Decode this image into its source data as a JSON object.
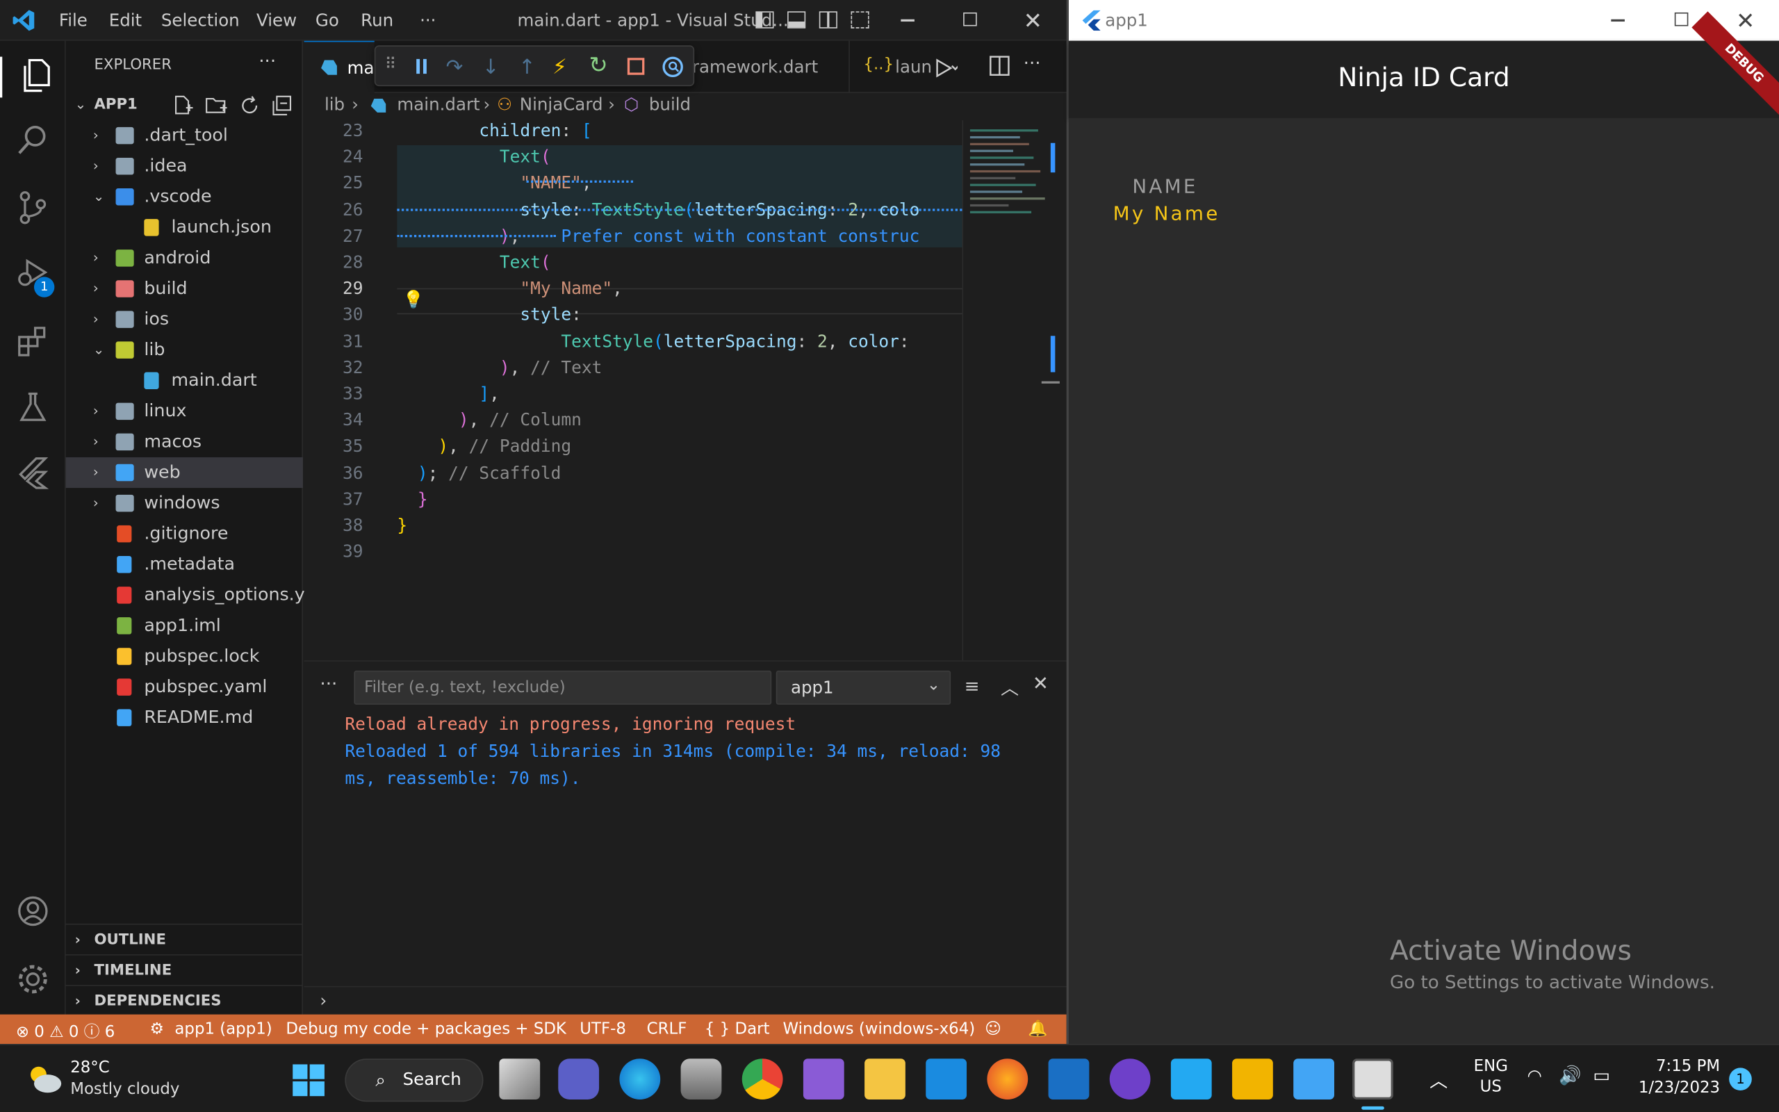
{
  "vscode": {
    "title": "main.dart - app1 - Visual Stud...",
    "menus": [
      "File",
      "Edit",
      "Selection",
      "View",
      "Go",
      "Run",
      "···"
    ],
    "explorer": {
      "header": "EXPLORER",
      "project": "APP1",
      "items": [
        {
          "label": ".dart_tool",
          "type": "folder",
          "expanded": false,
          "depth": 0,
          "color": "#8fa3b3"
        },
        {
          "label": ".idea",
          "type": "folder",
          "expanded": false,
          "depth": 0,
          "color": "#8fa3b3"
        },
        {
          "label": ".vscode",
          "type": "folder",
          "expanded": true,
          "depth": 0,
          "color": "#3b8eea"
        },
        {
          "label": "launch.json",
          "type": "file",
          "depth": 1,
          "color": "#e8c22e"
        },
        {
          "label": "android",
          "type": "folder",
          "expanded": false,
          "depth": 0,
          "color": "#7cb342"
        },
        {
          "label": "build",
          "type": "folder",
          "expanded": false,
          "depth": 0,
          "color": "#e57373"
        },
        {
          "label": "ios",
          "type": "folder",
          "expanded": false,
          "depth": 0,
          "color": "#8fa3b3"
        },
        {
          "label": "lib",
          "type": "folder",
          "expanded": true,
          "depth": 0,
          "color": "#c0ca33"
        },
        {
          "label": "main.dart",
          "type": "file",
          "depth": 1,
          "color": "#40a8e0"
        },
        {
          "label": "linux",
          "type": "folder",
          "expanded": false,
          "depth": 0,
          "color": "#8fa3b3"
        },
        {
          "label": "macos",
          "type": "folder",
          "expanded": false,
          "depth": 0,
          "color": "#8fa3b3"
        },
        {
          "label": "web",
          "type": "folder",
          "expanded": false,
          "depth": 0,
          "color": "#42a5f5",
          "selected": true
        },
        {
          "label": "windows",
          "type": "folder",
          "expanded": false,
          "depth": 0,
          "color": "#8fa3b3"
        },
        {
          "label": ".gitignore",
          "type": "file",
          "depth": 0,
          "color": "#e44d26"
        },
        {
          "label": ".metadata",
          "type": "file",
          "depth": 0,
          "color": "#42a5f5"
        },
        {
          "label": "analysis_options.y...",
          "type": "file",
          "depth": 0,
          "color": "#e53935"
        },
        {
          "label": "app1.iml",
          "type": "file",
          "depth": 0,
          "color": "#7cb342"
        },
        {
          "label": "pubspec.lock",
          "type": "file",
          "depth": 0,
          "color": "#fbc02d"
        },
        {
          "label": "pubspec.yaml",
          "type": "file",
          "depth": 0,
          "color": "#e53935"
        },
        {
          "label": "README.md",
          "type": "file",
          "depth": 0,
          "color": "#42a5f5"
        }
      ],
      "sections": [
        "OUTLINE",
        "TIMELINE",
        "DEPENDENCIES"
      ]
    },
    "tabs": [
      "ma",
      "ramework.dart",
      "laun"
    ],
    "breadcrumb": [
      "lib",
      "main.dart",
      "NinjaCard",
      "build"
    ],
    "code_lines": [
      {
        "n": "23",
        "html": "        <span class='kw'>children</span>: <span class='p3'>[</span>"
      },
      {
        "n": "24",
        "html": "          <span class='cls'>Text</span><span class='p2'>(</span>"
      },
      {
        "n": "25",
        "html": "            <span class='str'>\"NAME\"</span>,"
      },
      {
        "n": "26",
        "html": "            <span class='kw'>style</span>: <span class='cls'>TextStyle</span><span class='p3'>(</span><span class='kw'>letterSpacing</span>: <span class='num'>2</span>, <span class='kw'>colo</span>"
      },
      {
        "n": "27",
        "html": "          <span class='p2'>)</span>,    <span style='color:#3794ff'>Prefer const with constant construc</span>"
      },
      {
        "n": "28",
        "html": "          <span class='cls'>Text</span><span class='p2'>(</span>"
      },
      {
        "n": "29",
        "html": "            <span class='str'>\"My Name\"</span>,"
      },
      {
        "n": "30",
        "html": "            <span class='kw'>style</span>:"
      },
      {
        "n": "31",
        "html": "                <span class='cls'>TextStyle</span><span class='p3'>(</span><span class='kw'>letterSpacing</span>: <span class='num'>2</span>, <span class='kw'>color</span>:"
      },
      {
        "n": "32",
        "html": "          <span class='p2'>)</span>, <span class='cm'>// Text</span>"
      },
      {
        "n": "33",
        "html": "        <span class='p3'>]</span>,"
      },
      {
        "n": "34",
        "html": "      <span class='p2'>)</span>, <span class='cm'>// Column</span>"
      },
      {
        "n": "35",
        "html": "    <span class='p1'>)</span>, <span class='cm'>// Padding</span>"
      },
      {
        "n": "36",
        "html": "  <span class='p3'>)</span>; <span class='cm'>// Scaffold</span>"
      },
      {
        "n": "37",
        "html": "  <span class='p2'>}</span>"
      },
      {
        "n": "38",
        "html": "<span class='p1'>}</span>"
      },
      {
        "n": "39",
        "html": ""
      }
    ],
    "panel": {
      "filter_placeholder": "Filter (e.g. text, !exclude)",
      "channel": "app1",
      "lines": [
        {
          "text": "Reload already in progress, ignoring request",
          "color": "#f48771"
        },
        {
          "text": "Reloaded 1 of 594 libraries in 314ms (compile: 34 ms, reload: 98",
          "color": "#3794ff"
        },
        {
          "text": "ms, reassemble: 70 ms).",
          "color": "#3794ff"
        }
      ]
    },
    "status": {
      "problems": "⊗ 0 ⚠ 0 ⓘ 6",
      "debug": "app1 (app1)",
      "mode": "Debug my code + packages + SDK",
      "encoding": "UTF-8",
      "eol": "CRLF",
      "language": "{ } Dart",
      "device": "Windows (windows-x64)",
      "color": "#cc6633"
    },
    "debug_badge": "1"
  },
  "app": {
    "window_title": "app1",
    "appbar_title": "Ninja ID Card",
    "banner": "DEBUG",
    "label": "NAME",
    "name": "My Name",
    "watermark_title": "Activate Windows",
    "watermark_sub": "Go to Settings to activate Windows."
  },
  "taskbar": {
    "weather_temp": "28°C",
    "weather_desc": "Mostly cloudy",
    "search": "Search",
    "lang_top": "ENG",
    "lang_bottom": "US",
    "time": "7:15 PM",
    "date": "1/23/2023",
    "notif": "1"
  }
}
